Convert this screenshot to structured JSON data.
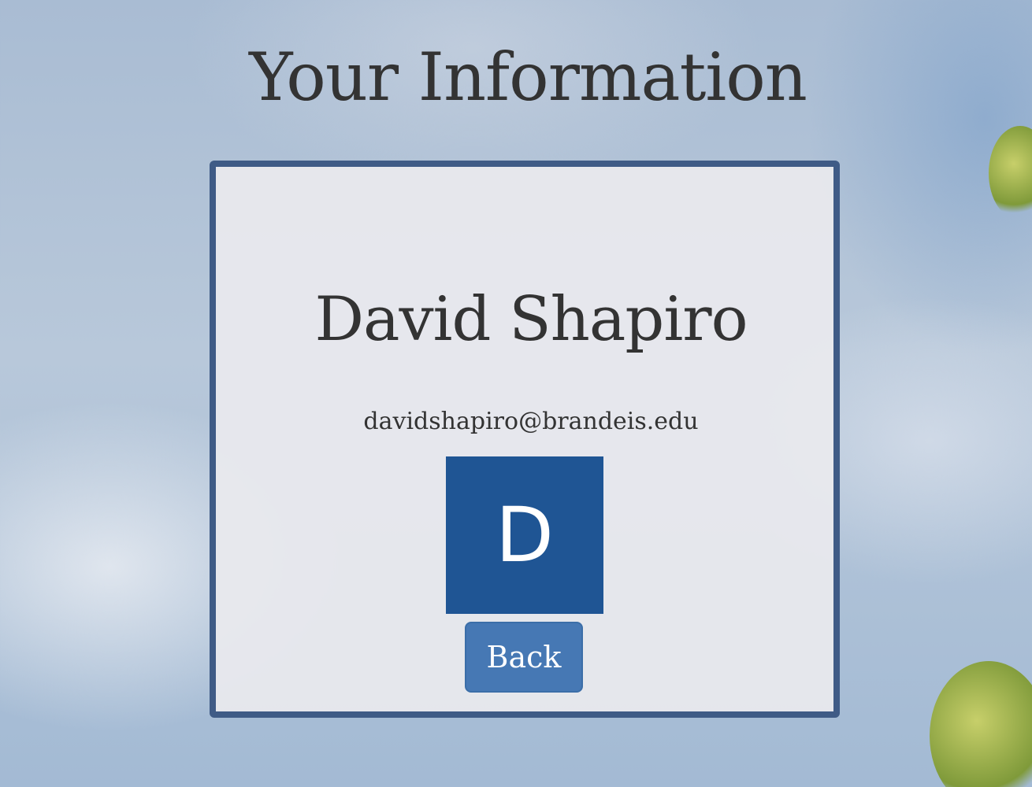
{
  "page": {
    "title": "Your Information"
  },
  "profile": {
    "name": "David Shapiro",
    "email": "davidshapiro@brandeis.edu",
    "avatar_initial": "D",
    "avatar_color": "#1f5594"
  },
  "actions": {
    "back_label": "Back",
    "button_color": "#4678b4"
  },
  "theme": {
    "card_border_color": "#3f5b86",
    "text_color": "#333333"
  }
}
